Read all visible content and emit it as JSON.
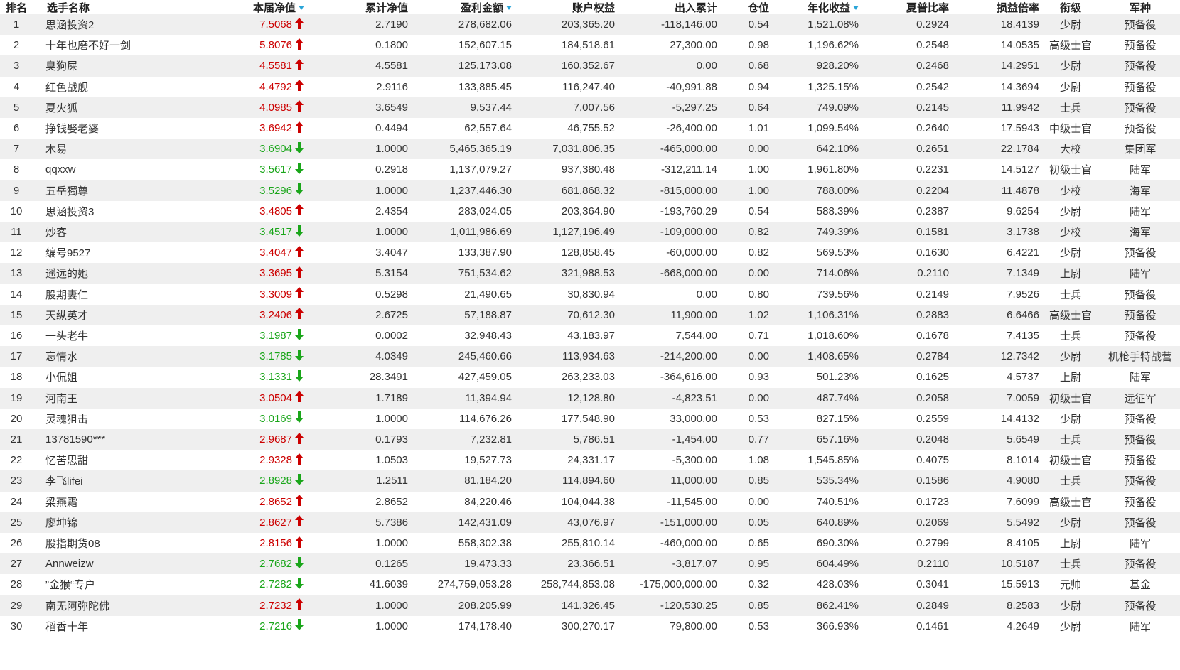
{
  "colors": {
    "up": "#cc0000",
    "down": "#1aa61a",
    "sort_indicator": "#2aa5d8",
    "stripe": "#efefef"
  },
  "icons": {
    "up": "red-up-arrow-icon",
    "down": "green-down-arrow-icon",
    "sort": "sort-desc-icon"
  },
  "columns": {
    "rank": "排名",
    "name": "选手名称",
    "net_value": "本届净值",
    "cumulative": "累计净值",
    "profit": "盈利金额",
    "equity": "账户权益",
    "flow": "出入累计",
    "position": "仓位",
    "annual": "年化收益",
    "sharpe": "夏普比率",
    "pl_ratio": "损益倍率",
    "title": "衔级",
    "army": "军种"
  },
  "rows": [
    {
      "rank": "1",
      "name": "思涵投资2",
      "nv": "7.5068",
      "trend": "up",
      "cum": "2.7190",
      "profit": "278,682.06",
      "equity": "203,365.20",
      "flow": "-118,146.00",
      "pos": "0.54",
      "annual": "1,521.08%",
      "sharpe": "0.2924",
      "plr": "18.4139",
      "title": "少尉",
      "army": "预备役"
    },
    {
      "rank": "2",
      "name": "十年也磨不好一剑",
      "nv": "5.8076",
      "trend": "up",
      "cum": "0.1800",
      "profit": "152,607.15",
      "equity": "184,518.61",
      "flow": "27,300.00",
      "pos": "0.98",
      "annual": "1,196.62%",
      "sharpe": "0.2548",
      "plr": "14.0535",
      "title": "高级士官",
      "army": "预备役"
    },
    {
      "rank": "3",
      "name": "臭狗屎",
      "nv": "4.5581",
      "trend": "up",
      "cum": "4.5581",
      "profit": "125,173.08",
      "equity": "160,352.67",
      "flow": "0.00",
      "pos": "0.68",
      "annual": "928.20%",
      "sharpe": "0.2468",
      "plr": "14.2951",
      "title": "少尉",
      "army": "预备役"
    },
    {
      "rank": "4",
      "name": "红色战舰",
      "nv": "4.4792",
      "trend": "up",
      "cum": "2.9116",
      "profit": "133,885.45",
      "equity": "116,247.40",
      "flow": "-40,991.88",
      "pos": "0.94",
      "annual": "1,325.15%",
      "sharpe": "0.2542",
      "plr": "14.3694",
      "title": "少尉",
      "army": "预备役"
    },
    {
      "rank": "5",
      "name": "夏火狐",
      "nv": "4.0985",
      "trend": "up",
      "cum": "3.6549",
      "profit": "9,537.44",
      "equity": "7,007.56",
      "flow": "-5,297.25",
      "pos": "0.64",
      "annual": "749.09%",
      "sharpe": "0.2145",
      "plr": "11.9942",
      "title": "士兵",
      "army": "预备役"
    },
    {
      "rank": "6",
      "name": "挣钱娶老婆",
      "nv": "3.6942",
      "trend": "up",
      "cum": "0.4494",
      "profit": "62,557.64",
      "equity": "46,755.52",
      "flow": "-26,400.00",
      "pos": "1.01",
      "annual": "1,099.54%",
      "sharpe": "0.2640",
      "plr": "17.5943",
      "title": "中级士官",
      "army": "预备役"
    },
    {
      "rank": "7",
      "name": "木易",
      "nv": "3.6904",
      "trend": "down",
      "cum": "1.0000",
      "profit": "5,465,365.19",
      "equity": "7,031,806.35",
      "flow": "-465,000.00",
      "pos": "0.00",
      "annual": "642.10%",
      "sharpe": "0.2651",
      "plr": "22.1784",
      "title": "大校",
      "army": "集团军"
    },
    {
      "rank": "8",
      "name": "qqxxw",
      "nv": "3.5617",
      "trend": "down",
      "cum": "0.2918",
      "profit": "1,137,079.27",
      "equity": "937,380.48",
      "flow": "-312,211.14",
      "pos": "1.00",
      "annual": "1,961.80%",
      "sharpe": "0.2231",
      "plr": "14.5127",
      "title": "初级士官",
      "army": "陆军"
    },
    {
      "rank": "9",
      "name": "五岳獨尊",
      "nv": "3.5296",
      "trend": "down",
      "cum": "1.0000",
      "profit": "1,237,446.30",
      "equity": "681,868.32",
      "flow": "-815,000.00",
      "pos": "1.00",
      "annual": "788.00%",
      "sharpe": "0.2204",
      "plr": "11.4878",
      "title": "少校",
      "army": "海军"
    },
    {
      "rank": "10",
      "name": "思涵投资3",
      "nv": "3.4805",
      "trend": "up",
      "cum": "2.4354",
      "profit": "283,024.05",
      "equity": "203,364.90",
      "flow": "-193,760.29",
      "pos": "0.54",
      "annual": "588.39%",
      "sharpe": "0.2387",
      "plr": "9.6254",
      "title": "少尉",
      "army": "陆军"
    },
    {
      "rank": "11",
      "name": "炒客",
      "nv": "3.4517",
      "trend": "down",
      "cum": "1.0000",
      "profit": "1,011,986.69",
      "equity": "1,127,196.49",
      "flow": "-109,000.00",
      "pos": "0.82",
      "annual": "749.39%",
      "sharpe": "0.1581",
      "plr": "3.1738",
      "title": "少校",
      "army": "海军"
    },
    {
      "rank": "12",
      "name": "编号9527",
      "nv": "3.4047",
      "trend": "up",
      "cum": "3.4047",
      "profit": "133,387.90",
      "equity": "128,858.45",
      "flow": "-60,000.00",
      "pos": "0.82",
      "annual": "569.53%",
      "sharpe": "0.1630",
      "plr": "6.4221",
      "title": "少尉",
      "army": "预备役"
    },
    {
      "rank": "13",
      "name": "遥远的她",
      "nv": "3.3695",
      "trend": "up",
      "cum": "5.3154",
      "profit": "751,534.62",
      "equity": "321,988.53",
      "flow": "-668,000.00",
      "pos": "0.00",
      "annual": "714.06%",
      "sharpe": "0.2110",
      "plr": "7.1349",
      "title": "上尉",
      "army": "陆军"
    },
    {
      "rank": "14",
      "name": "股期妻仁",
      "nv": "3.3009",
      "trend": "up",
      "cum": "0.5298",
      "profit": "21,490.65",
      "equity": "30,830.94",
      "flow": "0.00",
      "pos": "0.80",
      "annual": "739.56%",
      "sharpe": "0.2149",
      "plr": "7.9526",
      "title": "士兵",
      "army": "预备役"
    },
    {
      "rank": "15",
      "name": "天纵英才",
      "nv": "3.2406",
      "trend": "up",
      "cum": "2.6725",
      "profit": "57,188.87",
      "equity": "70,612.30",
      "flow": "11,900.00",
      "pos": "1.02",
      "annual": "1,106.31%",
      "sharpe": "0.2883",
      "plr": "6.6466",
      "title": "高级士官",
      "army": "预备役"
    },
    {
      "rank": "16",
      "name": "一头老牛",
      "nv": "3.1987",
      "trend": "down",
      "cum": "0.0002",
      "profit": "32,948.43",
      "equity": "43,183.97",
      "flow": "7,544.00",
      "pos": "0.71",
      "annual": "1,018.60%",
      "sharpe": "0.1678",
      "plr": "7.4135",
      "title": "士兵",
      "army": "预备役"
    },
    {
      "rank": "17",
      "name": "忘情水",
      "nv": "3.1785",
      "trend": "down",
      "cum": "4.0349",
      "profit": "245,460.66",
      "equity": "113,934.63",
      "flow": "-214,200.00",
      "pos": "0.00",
      "annual": "1,408.65%",
      "sharpe": "0.2784",
      "plr": "12.7342",
      "title": "少尉",
      "army": "机枪手特战营"
    },
    {
      "rank": "18",
      "name": "小侃姐",
      "nv": "3.1331",
      "trend": "down",
      "cum": "28.3491",
      "profit": "427,459.05",
      "equity": "263,233.03",
      "flow": "-364,616.00",
      "pos": "0.93",
      "annual": "501.23%",
      "sharpe": "0.1625",
      "plr": "4.5737",
      "title": "上尉",
      "army": "陆军"
    },
    {
      "rank": "19",
      "name": "河南王",
      "nv": "3.0504",
      "trend": "up",
      "cum": "1.7189",
      "profit": "11,394.94",
      "equity": "12,128.80",
      "flow": "-4,823.51",
      "pos": "0.00",
      "annual": "487.74%",
      "sharpe": "0.2058",
      "plr": "7.0059",
      "title": "初级士官",
      "army": "远征军"
    },
    {
      "rank": "20",
      "name": "灵魂狙击",
      "nv": "3.0169",
      "trend": "down",
      "cum": "1.0000",
      "profit": "114,676.26",
      "equity": "177,548.90",
      "flow": "33,000.00",
      "pos": "0.53",
      "annual": "827.15%",
      "sharpe": "0.2559",
      "plr": "14.4132",
      "title": "少尉",
      "army": "预备役"
    },
    {
      "rank": "21",
      "name": "13781590***",
      "nv": "2.9687",
      "trend": "up",
      "cum": "0.1793",
      "profit": "7,232.81",
      "equity": "5,786.51",
      "flow": "-1,454.00",
      "pos": "0.77",
      "annual": "657.16%",
      "sharpe": "0.2048",
      "plr": "5.6549",
      "title": "士兵",
      "army": "预备役"
    },
    {
      "rank": "22",
      "name": "忆苦思甜",
      "nv": "2.9328",
      "trend": "up",
      "cum": "1.0503",
      "profit": "19,527.73",
      "equity": "24,331.17",
      "flow": "-5,300.00",
      "pos": "1.08",
      "annual": "1,545.85%",
      "sharpe": "0.4075",
      "plr": "8.1014",
      "title": "初级士官",
      "army": "预备役"
    },
    {
      "rank": "23",
      "name": "李飞lifei",
      "nv": "2.8928",
      "trend": "down",
      "cum": "1.2511",
      "profit": "81,184.20",
      "equity": "114,894.60",
      "flow": "11,000.00",
      "pos": "0.85",
      "annual": "535.34%",
      "sharpe": "0.1586",
      "plr": "4.9080",
      "title": "士兵",
      "army": "预备役"
    },
    {
      "rank": "24",
      "name": "梁燕霜",
      "nv": "2.8652",
      "trend": "up",
      "cum": "2.8652",
      "profit": "84,220.46",
      "equity": "104,044.38",
      "flow": "-11,545.00",
      "pos": "0.00",
      "annual": "740.51%",
      "sharpe": "0.1723",
      "plr": "7.6099",
      "title": "高级士官",
      "army": "预备役"
    },
    {
      "rank": "25",
      "name": "廖坤锦",
      "nv": "2.8627",
      "trend": "up",
      "cum": "5.7386",
      "profit": "142,431.09",
      "equity": "43,076.97",
      "flow": "-151,000.00",
      "pos": "0.05",
      "annual": "640.89%",
      "sharpe": "0.2069",
      "plr": "5.5492",
      "title": "少尉",
      "army": "预备役"
    },
    {
      "rank": "26",
      "name": "股指期货08",
      "nv": "2.8156",
      "trend": "up",
      "cum": "1.0000",
      "profit": "558,302.38",
      "equity": "255,810.14",
      "flow": "-460,000.00",
      "pos": "0.65",
      "annual": "690.30%",
      "sharpe": "0.2799",
      "plr": "8.4105",
      "title": "上尉",
      "army": "陆军"
    },
    {
      "rank": "27",
      "name": "Annweizw",
      "nv": "2.7682",
      "trend": "down",
      "cum": "0.1265",
      "profit": "19,473.33",
      "equity": "23,366.51",
      "flow": "-3,817.07",
      "pos": "0.95",
      "annual": "604.49%",
      "sharpe": "0.2110",
      "plr": "10.5187",
      "title": "士兵",
      "army": "预备役"
    },
    {
      "rank": "28",
      "name": "”金猴“专户",
      "nv": "2.7282",
      "trend": "down",
      "cum": "41.6039",
      "profit": "274,759,053.28",
      "equity": "258,744,853.08",
      "flow": "-175,000,000.00",
      "pos": "0.32",
      "annual": "428.03%",
      "sharpe": "0.3041",
      "plr": "15.5913",
      "title": "元帅",
      "army": "基金"
    },
    {
      "rank": "29",
      "name": "南无阿弥陀佛",
      "nv": "2.7232",
      "trend": "up",
      "cum": "1.0000",
      "profit": "208,205.99",
      "equity": "141,326.45",
      "flow": "-120,530.25",
      "pos": "0.85",
      "annual": "862.41%",
      "sharpe": "0.2849",
      "plr": "8.2583",
      "title": "少尉",
      "army": "预备役"
    },
    {
      "rank": "30",
      "name": "稻香十年",
      "nv": "2.7216",
      "trend": "down",
      "cum": "1.0000",
      "profit": "174,178.40",
      "equity": "300,270.17",
      "flow": "79,800.00",
      "pos": "0.53",
      "annual": "366.93%",
      "sharpe": "0.1461",
      "plr": "4.2649",
      "title": "少尉",
      "army": "陆军"
    }
  ]
}
